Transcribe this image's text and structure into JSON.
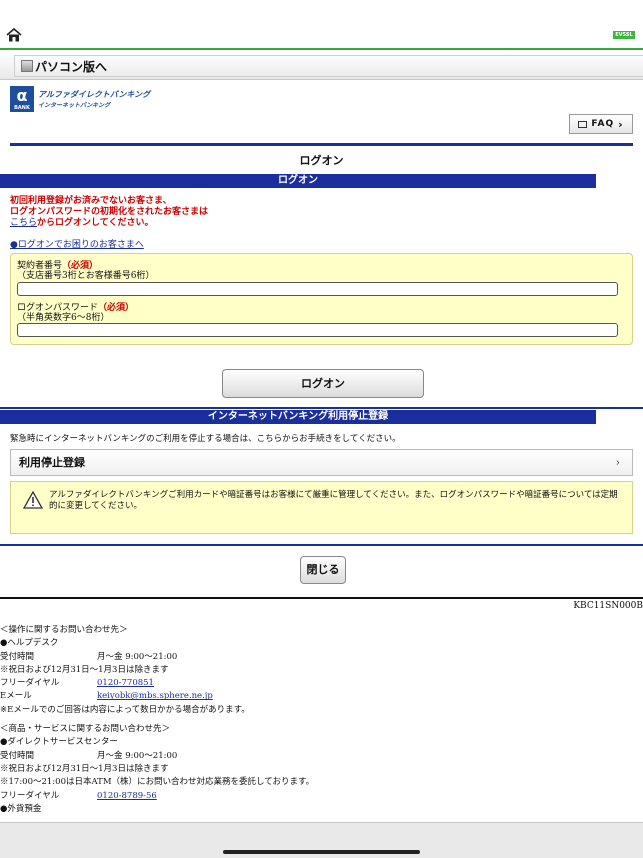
{
  "topbar": {
    "evssl": "EVSSL"
  },
  "pc_version": "パソコン版へ",
  "logo": {
    "mark": "α",
    "bank": "BANK",
    "name": "アルファダイレクトバンキング",
    "sub": "インターネットバンキング"
  },
  "faq": "FAQ",
  "page_title": "ログオン",
  "login_band": "ログオン",
  "notice": {
    "line1": "初回利用登録がお済みでないお客さま、",
    "line2": "ログオンパスワードの初期化をされたお客さまは",
    "link": "こちら",
    "line3_rest": "からログオンしてください。"
  },
  "help_link": "●ログオンでお困りのお客さまへ",
  "form": {
    "contract_label": "契約者番号",
    "contract_req": "（必須）",
    "contract_hint": "（支店番号3桁とお客様番号6桁）",
    "contract_value": "",
    "password_label": "ログオンパスワード",
    "password_req": "（必須）",
    "password_hint": "（半角英数字6〜8桁）",
    "password_value": ""
  },
  "login_button": "ログオン",
  "stop_band": "インターネットバンキング利用停止登録",
  "stop_text": "緊急時にインターネットバンキングのご利用を停止する場合は、こちらからお手続きをしてください。",
  "stop_row": "利用停止登録",
  "warning": "アルファダイレクトバンキングご利用カードや暗証番号はお客様にて厳重に管理してください。また、ログオンパスワードや暗証番号については定期的に変更してください。",
  "close_button": "閉じる",
  "screen_code": "KBC11SN000B",
  "contact": {
    "ops_heading": "＜操作に関するお問い合わせ先＞",
    "helpdesk": "●ヘルプデスク",
    "hours_label": "受付時間",
    "hours_value": "月〜金 9:00〜21:00",
    "holiday_note": "※祝日および12月31日〜1月3日は除きます",
    "freedial_label": "フリーダイヤル",
    "helpdesk_phone": "0120-770851",
    "email_label": "Eメール",
    "email_value": "keiyobk@mbs.sphere.ne.jp",
    "email_note": "※Eメールでのご回答は内容によって数日かかる場合があります。",
    "svc_heading": "＜商品・サービスに関するお問い合わせ先＞",
    "direct_center": "●ダイレクトサービスセンター",
    "svc_hours_label": "受付時間",
    "svc_hours_value": "月〜金 9:00〜21:00",
    "svc_holiday_note": "※祝日および12月31日〜1月3日は除きます",
    "atm_note": "※17:00〜21:00は日本ATM（株）にお問い合わせ対応業務を委託しております。",
    "svc_freedial_label": "フリーダイヤル",
    "svc_phone": "0120-8789-56",
    "foreign": "●外貨預金"
  }
}
